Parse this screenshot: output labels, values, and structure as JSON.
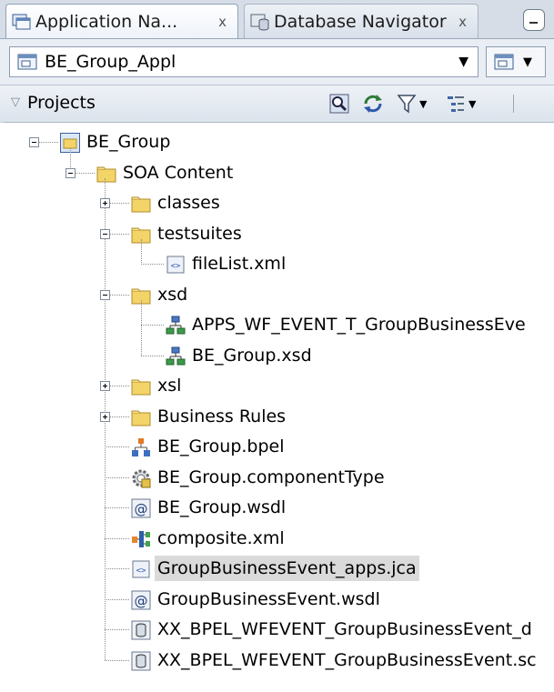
{
  "tabs": [
    {
      "label": "Application Na...",
      "icon": "application-navigator-icon",
      "close": "x",
      "active": true
    },
    {
      "label": "Database Navigator",
      "icon": "database-navigator-icon",
      "close": "x",
      "active": false
    }
  ],
  "application": {
    "selected": "BE_Group_Appl"
  },
  "projects": {
    "title": "Projects"
  },
  "tree": [
    {
      "label": "BE_Group",
      "icon": "project-folder",
      "depth": 0,
      "toggle": "minus"
    },
    {
      "label": "SOA Content",
      "icon": "folder",
      "depth": 1,
      "toggle": "minus"
    },
    {
      "label": "classes",
      "icon": "folder",
      "depth": 2,
      "toggle": "plus"
    },
    {
      "label": "testsuites",
      "icon": "folder",
      "depth": 2,
      "toggle": "minus"
    },
    {
      "label": "fileList.xml",
      "icon": "xml-file",
      "depth": 3,
      "toggle": "none"
    },
    {
      "label": "xsd",
      "icon": "folder",
      "depth": 2,
      "toggle": "minus"
    },
    {
      "label": "APPS_WF_EVENT_T_GroupBusinessEve",
      "icon": "schema",
      "depth": 3,
      "toggle": "none"
    },
    {
      "label": "BE_Group.xsd",
      "icon": "schema",
      "depth": 3,
      "toggle": "none"
    },
    {
      "label": "xsl",
      "icon": "folder",
      "depth": 2,
      "toggle": "plus"
    },
    {
      "label": "Business Rules",
      "icon": "folder",
      "depth": 2,
      "toggle": "plus"
    },
    {
      "label": "BE_Group.bpel",
      "icon": "bpel",
      "depth": 2,
      "toggle": "none"
    },
    {
      "label": "BE_Group.componentType",
      "icon": "component-type",
      "depth": 2,
      "toggle": "none"
    },
    {
      "label": "BE_Group.wsdl",
      "icon": "wsdl",
      "depth": 2,
      "toggle": "none"
    },
    {
      "label": "composite.xml",
      "icon": "composite",
      "depth": 2,
      "toggle": "none"
    },
    {
      "label": "GroupBusinessEvent_apps.jca",
      "icon": "xml-file",
      "depth": 2,
      "toggle": "none",
      "selected": true
    },
    {
      "label": "GroupBusinessEvent.wsdl",
      "icon": "wsdl",
      "depth": 2,
      "toggle": "none"
    },
    {
      "label": "XX_BPEL_WFEVENT_GroupBusinessEvent_d",
      "icon": "database",
      "depth": 2,
      "toggle": "none"
    },
    {
      "label": "XX_BPEL_WFEVENT_GroupBusinessEvent.sc",
      "icon": "database",
      "depth": 2,
      "toggle": "none"
    }
  ]
}
